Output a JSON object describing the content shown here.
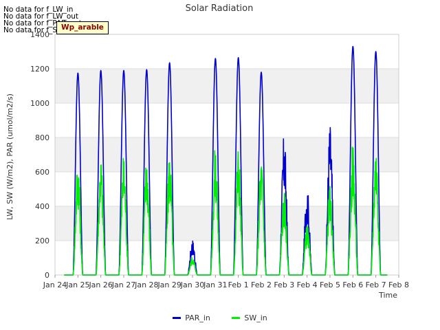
{
  "notices": [
    "No data for f_LW_in",
    "No data for f_LW_out",
    "No data for f_PAR_out",
    "No data for f_SW_out"
  ],
  "tag_label": "Wp_arable",
  "chart_data": {
    "type": "line",
    "title": "Solar Radiation",
    "xlabel": "Time",
    "ylabel": "LW, SW (W/m2), PAR (umol/m2/s)",
    "x_start": "2022-01-24",
    "x_end": "2022-02-08",
    "x_ticks": [
      "Jan 24",
      "Jan 25",
      "Jan 26",
      "Jan 27",
      "Jan 28",
      "Jan 29",
      "Jan 30",
      "Jan 31",
      "Feb 1",
      "Feb 2",
      "Feb 3",
      "Feb 4",
      "Feb 5",
      "Feb 6",
      "Feb 7",
      "Feb 8"
    ],
    "ylim": [
      0,
      1400
    ],
    "y_ticks": [
      0,
      200,
      400,
      600,
      800,
      1000,
      1200,
      1400
    ],
    "grid": true,
    "legend_position": "bottom",
    "series": [
      {
        "name": "PAR_in",
        "color": "#0000cc",
        "daily_peaks": [
          {
            "date": "Jan 25",
            "value": 1175
          },
          {
            "date": "Jan 26",
            "value": 1190
          },
          {
            "date": "Jan 27",
            "value": 1190
          },
          {
            "date": "Jan 28",
            "value": 1195
          },
          {
            "date": "Jan 29",
            "value": 1235
          },
          {
            "date": "Jan 30",
            "value": 210
          },
          {
            "date": "Jan 31",
            "value": 1260
          },
          {
            "date": "Feb 1",
            "value": 1265
          },
          {
            "date": "Feb 2",
            "value": 1180
          },
          {
            "date": "Feb 3",
            "value": 835
          },
          {
            "date": "Feb 4",
            "value": 530
          },
          {
            "date": "Feb 5",
            "value": 895
          },
          {
            "date": "Feb 6",
            "value": 1330
          },
          {
            "date": "Feb 7",
            "value": 1300
          }
        ]
      },
      {
        "name": "SW_in",
        "color": "#00ee00",
        "daily_peaks": [
          {
            "date": "Jan 25",
            "value": 700
          },
          {
            "date": "Jan 26",
            "value": 710
          },
          {
            "date": "Jan 27",
            "value": 712
          },
          {
            "date": "Jan 28",
            "value": 715
          },
          {
            "date": "Jan 29",
            "value": 735
          },
          {
            "date": "Jan 30",
            "value": 110
          },
          {
            "date": "Jan 31",
            "value": 755
          },
          {
            "date": "Feb 1",
            "value": 760
          },
          {
            "date": "Feb 2",
            "value": 705
          },
          {
            "date": "Feb 3",
            "value": 500
          },
          {
            "date": "Feb 4",
            "value": 300
          },
          {
            "date": "Feb 5",
            "value": 530
          },
          {
            "date": "Feb 6",
            "value": 790
          },
          {
            "date": "Feb 7",
            "value": 775
          }
        ]
      }
    ]
  }
}
